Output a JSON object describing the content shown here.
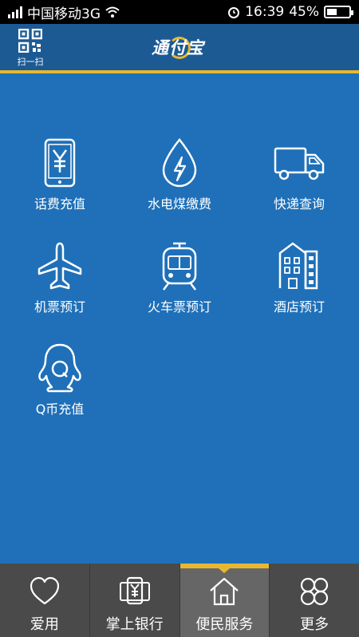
{
  "status_bar": {
    "carrier": "中国移动3G",
    "time": "16:39",
    "battery": "45%"
  },
  "header": {
    "scan_label": "扫一扫",
    "logo_text": "通付宝"
  },
  "services": [
    {
      "label": "话费充值",
      "icon": "phone-recharge-icon"
    },
    {
      "label": "水电煤缴费",
      "icon": "utility-payment-icon"
    },
    {
      "label": "快递查询",
      "icon": "delivery-truck-icon"
    },
    {
      "label": "机票预订",
      "icon": "airplane-icon"
    },
    {
      "label": "火车票预订",
      "icon": "train-icon"
    },
    {
      "label": "酒店预订",
      "icon": "hotel-icon"
    },
    {
      "label": "Q币充值",
      "icon": "qq-coin-icon"
    }
  ],
  "bottom_nav": [
    {
      "label": "爱用",
      "icon": "heart-icon",
      "active": false
    },
    {
      "label": "掌上银行",
      "icon": "mobile-bank-icon",
      "active": false
    },
    {
      "label": "便民服务",
      "icon": "home-icon",
      "active": true
    },
    {
      "label": "更多",
      "icon": "more-icon",
      "active": false
    }
  ],
  "colors": {
    "background": "#1f70b8",
    "header": "#1c5a94",
    "accent": "#e6b832",
    "nav": "#4a4a4a",
    "nav_active": "#666666"
  }
}
